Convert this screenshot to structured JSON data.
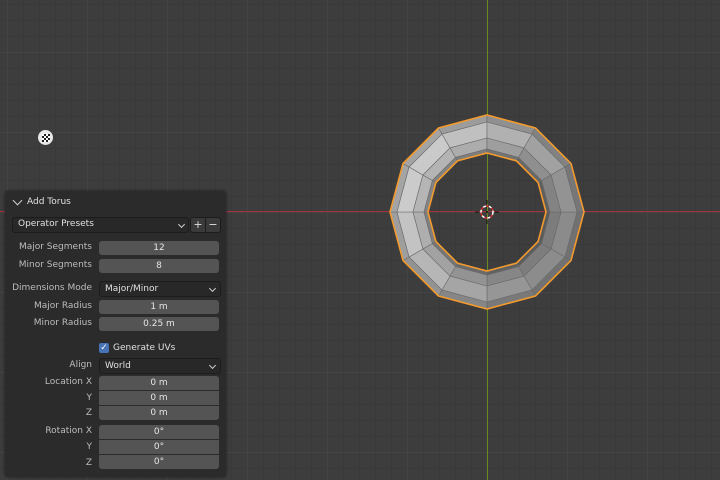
{
  "panel": {
    "title": "Add Torus",
    "presets": {
      "label": "Operator Presets",
      "add": "+",
      "remove": "−"
    },
    "major_segments": {
      "label": "Major Segments",
      "value": "12"
    },
    "minor_segments": {
      "label": "Minor Segments",
      "value": "8"
    },
    "dimensions_mode": {
      "label": "Dimensions Mode",
      "value": "Major/Minor"
    },
    "major_radius": {
      "label": "Major Radius",
      "value": "1 m"
    },
    "minor_radius": {
      "label": "Minor Radius",
      "value": "0.25 m"
    },
    "generate_uvs": {
      "label": "Generate UVs",
      "checked": true,
      "mark": "✓"
    },
    "align": {
      "label": "Align",
      "value": "World"
    },
    "location": {
      "label_x": "Location X",
      "label_y": "Y",
      "label_z": "Z",
      "x": "0 m",
      "y": "0 m",
      "z": "0 m"
    },
    "rotation": {
      "label_x": "Rotation X",
      "label_y": "Y",
      "label_z": "Z",
      "x": "0°",
      "y": "0°",
      "z": "0°"
    }
  },
  "colors": {
    "background": "#3d3d3d",
    "x_axis": "#a2323c",
    "y_axis": "#6b8a22",
    "selection_outline": "#f29a2e",
    "mesh": "#9a9a9a",
    "checkbox": "#4772b3"
  },
  "icons": {
    "gizmo": "checker-flag-icon",
    "cursor": "3d-cursor-icon",
    "collapse": "chevron-down-icon"
  },
  "scene": {
    "object": "torus",
    "major_segments": 12,
    "selected": true
  }
}
